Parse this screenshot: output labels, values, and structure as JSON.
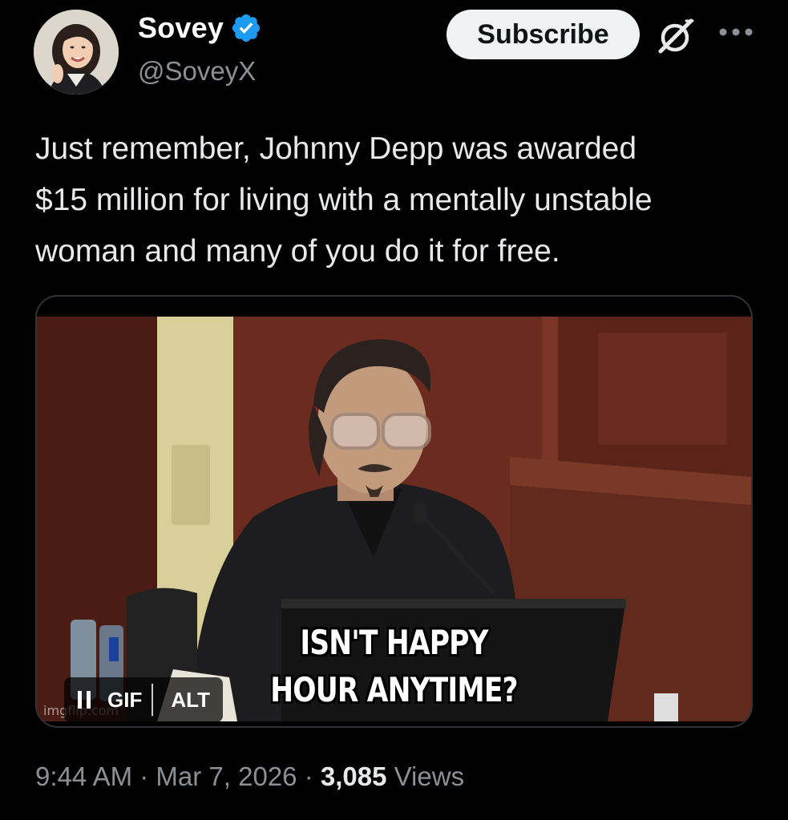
{
  "author": {
    "display_name": "Sovey",
    "handle": "@SoveyX",
    "verified": true
  },
  "header": {
    "subscribe_label": "Subscribe"
  },
  "tweet": {
    "text": "Just remember, Johnny Depp was awarded\n$15 million for living with a mentally unstable\nwoman and many of you do it for free."
  },
  "media": {
    "caption_line1": "ISN'T HAPPY",
    "caption_line2": "HOUR ANYTIME?",
    "watermark": "imgflip.com",
    "gif_label": "GIF",
    "alt_label": "ALT"
  },
  "footer": {
    "time": "9:44 AM",
    "separator": "·",
    "date": "Mar 7, 2026",
    "views_count": "3,085",
    "views_label": "Views"
  },
  "colors": {
    "background": "#000000",
    "verified_blue": "#1d9bf0",
    "text_primary": "#e7e9ea",
    "text_secondary": "#8b9096",
    "subscribe_bg": "#eff3f4"
  },
  "icons": {
    "verified": "verified-badge-icon",
    "grok": "grok-icon",
    "more": "more-horizontal-icon",
    "pause": "pause-icon"
  }
}
